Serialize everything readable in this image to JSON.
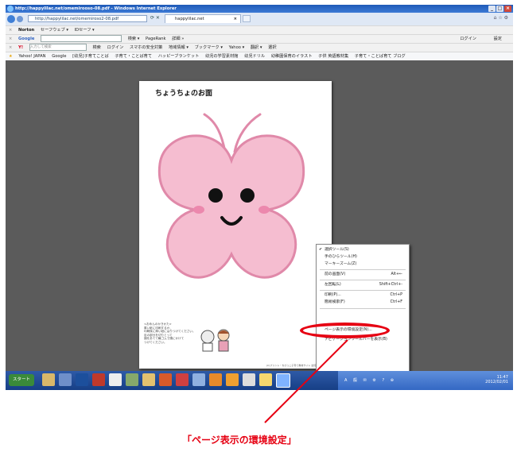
{
  "window": {
    "title": "http://happylilac.net/omemirooso-08.pdf - Windows Internet Explorer",
    "controls": [
      "_",
      "□",
      "×"
    ]
  },
  "address": {
    "url": "http://happylilac.net/omemiroso2-08.pdf",
    "tab_title": "happylilac.net",
    "right_tools": "⌂ ☆ ⚙"
  },
  "norton_bar": {
    "brand": "Norton",
    "items": [
      "セーフウェブ ▾",
      "IDセーフ ▾"
    ]
  },
  "google_bar": {
    "brand": "Google",
    "items": [
      "検索 ▾",
      "PageRank",
      "詳細 »",
      "ログイン",
      "設定"
    ]
  },
  "yahoo_bar": {
    "brand": "Y!",
    "search_placeholder": "入力して検索",
    "items": [
      "検索",
      "ログイン",
      "スマホの安全対策",
      "地域情報 ▾",
      "ブックマーク ▾",
      "Yahoo ▾",
      "翻訳 ▾",
      "選択"
    ]
  },
  "favorites": {
    "items": [
      "Yahoo! JAPAN",
      "Google",
      "[幼児]子育てことば",
      "子育て・ことば育て",
      "ハッピーブランケット",
      "幼児の学習素材館",
      "幼児ドリル",
      "幼稚園保育のイラスト",
      "子供 英語教材集",
      "子育て・ことば育て ブログ"
    ]
  },
  "document": {
    "title": "ちょうちょのお面",
    "notes": [
      "<おめんのかきかた>",
      "厚い紙に印刷するか、",
      "印刷後に厚い紙にはりつけてください。",
      "目の部分を切りとって",
      "顔をあてて輪ゴムで頭にかけて",
      "つけてください。"
    ],
    "credit": "(C)プリント・ちびっこ子育て教材サイト 幼児教材・知育プリント 無料の幼児用素材"
  },
  "context_menu": {
    "items": [
      {
        "label": "選択ツール(S)",
        "shortcut": "",
        "checked": true
      },
      {
        "label": "手のひらツール(H)",
        "shortcut": "",
        "checked": false
      },
      {
        "label": "マーキーズーム(Z)",
        "shortcut": "",
        "checked": false
      },
      {
        "label": "前の画面(V)",
        "shortcut": "Alt+←",
        "checked": false
      },
      {
        "label": "左回転(L)",
        "shortcut": "Shift+Ctrl+-",
        "checked": false
      },
      {
        "label": "印刷(P)...",
        "shortcut": "Ctrl+P",
        "checked": false
      },
      {
        "label": "簡易検索(F)",
        "shortcut": "Ctrl+F",
        "checked": false
      },
      {
        "label": "ページ表示の環境設定(N)...",
        "shortcut": "",
        "checked": false
      },
      {
        "label": "ナビゲーションツールバーを表示(B)",
        "shortcut": "",
        "checked": false
      }
    ]
  },
  "taskbar": {
    "start": "スタート",
    "time": "11:47",
    "date": "2012/02/01",
    "tray": "A 般 ✉ ⚙ ? ⊕"
  },
  "caption": "「ページ表示の環境設定」",
  "colors": {
    "highlight": "#e60012",
    "butterfly_fill": "#f5bdd0",
    "butterfly_stroke": "#e089a9"
  }
}
